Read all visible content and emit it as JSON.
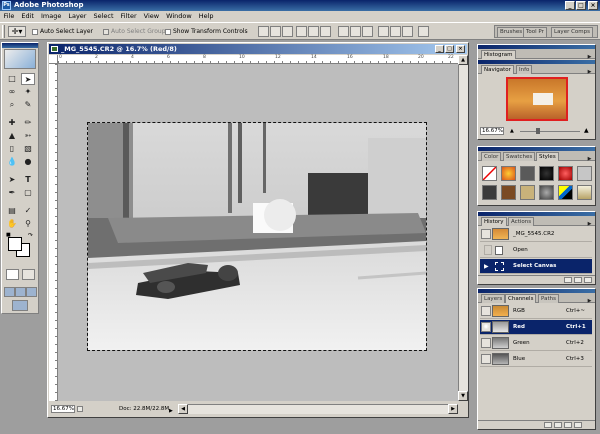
{
  "app": {
    "title": "Adobe Photoshop",
    "icon_label": "Ps",
    "window_controls": [
      "_",
      "□",
      "×"
    ]
  },
  "menus": [
    "File",
    "Edit",
    "Image",
    "Layer",
    "Select",
    "Filter",
    "View",
    "Window",
    "Help"
  ],
  "options_bar": {
    "auto_select_layer": "Auto Select Layer",
    "auto_select_groups": "Auto Select Groups",
    "show_transform_controls": "Show Transform Controls",
    "palette_well_tabs": [
      "Brushes",
      "Tool Pr",
      "Layer Comps"
    ]
  },
  "document": {
    "title": "_MG_5545.CR2 @ 16.7% (Red/8)",
    "zoom": "16.67%",
    "doc_size": "Doc: 22.8M/22.8M",
    "ruler_marks": [
      "0",
      "2",
      "4",
      "6",
      "8",
      "10",
      "12",
      "14",
      "16",
      "18",
      "20",
      "22"
    ]
  },
  "palettes": {
    "histogram": {
      "tabs": [
        "Histogram"
      ]
    },
    "navigator": {
      "tabs": [
        "Navigator",
        "Info"
      ],
      "zoom": "16.67%"
    },
    "color": {
      "tabs": [
        "Color",
        "Swatches",
        "Styles"
      ]
    },
    "history": {
      "tabs": [
        "History",
        "Actions"
      ],
      "snapshot": "_MG_5545.CR2",
      "items": [
        "Open",
        "Select Canvas"
      ]
    },
    "channels": {
      "tabs": [
        "Layers",
        "Channels",
        "Paths"
      ],
      "rows": [
        {
          "name": "RGB",
          "shortcut": "Ctrl+~"
        },
        {
          "name": "Red",
          "shortcut": "Ctrl+1"
        },
        {
          "name": "Green",
          "shortcut": "Ctrl+2"
        },
        {
          "name": "Blue",
          "shortcut": "Ctrl+3"
        }
      ]
    }
  },
  "colors": {
    "title_bar": "#0a246a",
    "selection": "#0a246a",
    "chrome": "#d4d0c8",
    "canvas_bg": "#bdbdbd",
    "pasteboard": "#9e9e9e"
  }
}
